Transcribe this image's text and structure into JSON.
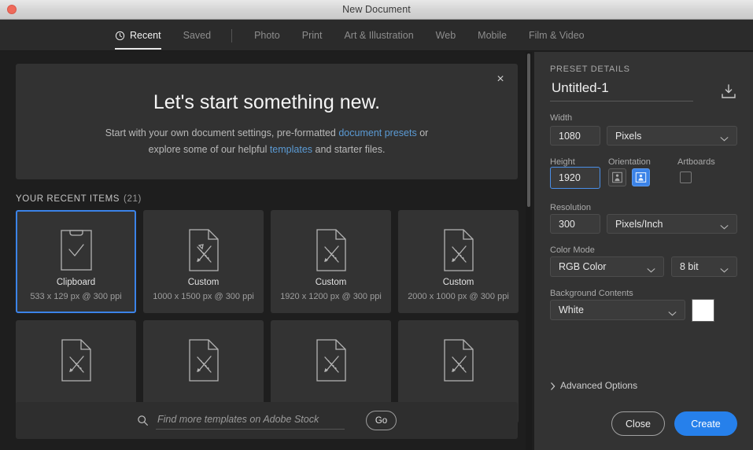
{
  "window": {
    "title": "New Document",
    "close_button": "close"
  },
  "tabs": [
    {
      "label": "Recent",
      "icon": "clock-icon",
      "active": true
    },
    {
      "label": "Saved",
      "icon": null,
      "active": false
    },
    {
      "label": "Photo",
      "icon": null,
      "active": false
    },
    {
      "label": "Print",
      "icon": null,
      "active": false
    },
    {
      "label": "Art & Illustration",
      "icon": null,
      "active": false
    },
    {
      "label": "Web",
      "icon": null,
      "active": false
    },
    {
      "label": "Mobile",
      "icon": null,
      "active": false
    },
    {
      "label": "Film & Video",
      "icon": null,
      "active": false
    }
  ],
  "banner": {
    "title": "Let's start something new.",
    "line1_pre": "Start with your own document settings, pre-formatted ",
    "line1_link": "document presets",
    "line1_post": " or",
    "line2_pre": "explore some of our helpful ",
    "line2_link": "templates",
    "line2_post": " and starter files.",
    "close_icon": "×"
  },
  "recent": {
    "heading": "YOUR RECENT ITEMS",
    "count": "(21)",
    "items": [
      {
        "label": "Clipboard",
        "meta": "533 x 129 px @ 300 ppi",
        "icon": "clipboard-check-icon",
        "selected": true
      },
      {
        "label": "Custom",
        "meta": "1000 x 1500 px @ 300 ppi",
        "icon": "document-pencil-ruler-icon",
        "selected": false
      },
      {
        "label": "Custom",
        "meta": "1920 x 1200 px @ 300 ppi",
        "icon": "document-pencil-ruler-icon",
        "selected": false
      },
      {
        "label": "Custom",
        "meta": "2000 x 1000 px @ 300 ppi",
        "icon": "document-pencil-ruler-icon",
        "selected": false
      },
      {
        "label": "",
        "meta": "",
        "icon": "document-pencil-ruler-icon",
        "selected": false
      },
      {
        "label": "",
        "meta": "",
        "icon": "document-pencil-ruler-icon",
        "selected": false
      },
      {
        "label": "",
        "meta": "",
        "icon": "document-pencil-ruler-icon",
        "selected": false
      },
      {
        "label": "",
        "meta": "",
        "icon": "document-pencil-ruler-icon",
        "selected": false
      }
    ]
  },
  "stock_search": {
    "placeholder": "Find more templates on Adobe Stock",
    "value": "",
    "icon": "search-icon",
    "go_label": "Go"
  },
  "preset": {
    "heading": "PRESET DETAILS",
    "doc_name": "Untitled-1",
    "save_icon": "save-preset-icon",
    "width_label": "Width",
    "width_value": "1080",
    "width_unit": "Pixels",
    "height_label": "Height",
    "height_value": "1920",
    "orientation_label": "Orientation",
    "orientation_landscape_icon": "orientation-landscape-icon",
    "orientation_portrait_icon": "orientation-portrait-icon",
    "orientation_selected": "portrait",
    "artboards_label": "Artboards",
    "artboards_checked": false,
    "resolution_label": "Resolution",
    "resolution_value": "300",
    "resolution_unit": "Pixels/Inch",
    "color_mode_label": "Color Mode",
    "color_mode_value": "RGB Color",
    "bit_depth_value": "8 bit",
    "background_label": "Background Contents",
    "background_value": "White",
    "background_swatch": "#ffffff",
    "advanced_options": "Advanced Options"
  },
  "actions": {
    "close_label": "Close",
    "create_label": "Create"
  },
  "colors": {
    "accent": "#2680eb",
    "selection": "#3b83e8",
    "link": "#5b9bd5",
    "panel_bg": "#333333",
    "app_bg": "#1e1e1e",
    "card_bg": "#333333"
  }
}
